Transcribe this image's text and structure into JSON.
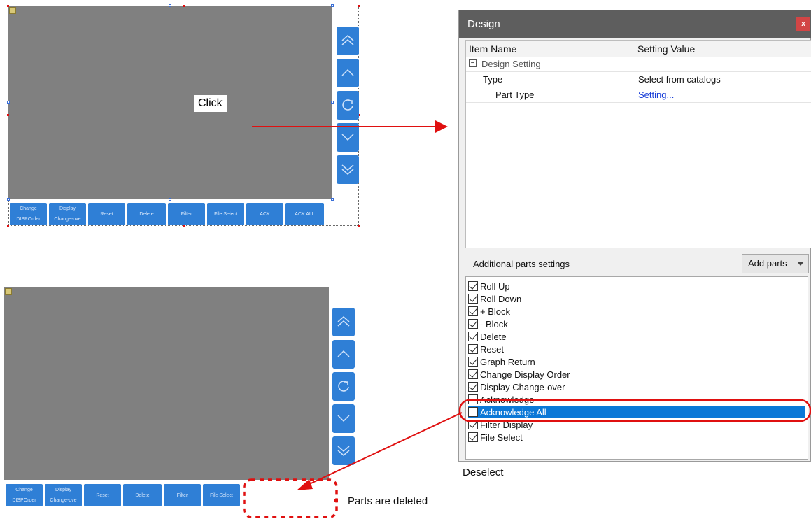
{
  "top_panel": {
    "click_label": "Click",
    "side_buttons": [
      "double-up",
      "up",
      "refresh",
      "down",
      "double-down"
    ],
    "bottom_buttons": [
      {
        "line1": "Change",
        "line2": "DISPOrder"
      },
      {
        "line1": "Display",
        "line2": "Change-ove"
      },
      {
        "line1": "Reset",
        "line2": ""
      },
      {
        "line1": "Delete",
        "line2": ""
      },
      {
        "line1": "Filter",
        "line2": ""
      },
      {
        "line1": "File Select",
        "line2": ""
      },
      {
        "line1": "ACK",
        "line2": ""
      },
      {
        "line1": "ACK ALL",
        "line2": ""
      }
    ]
  },
  "bottom_panel": {
    "side_buttons": [
      "double-up",
      "up",
      "refresh",
      "down",
      "double-down"
    ],
    "bottom_buttons": [
      {
        "line1": "Change",
        "line2": "DISPOrder"
      },
      {
        "line1": "Display",
        "line2": "Change-ove"
      },
      {
        "line1": "Reset",
        "line2": ""
      },
      {
        "line1": "Delete",
        "line2": ""
      },
      {
        "line1": "Filter",
        "line2": ""
      },
      {
        "line1": "File Select",
        "line2": ""
      }
    ],
    "deleted_note": "Parts are deleted"
  },
  "dialog": {
    "title": "Design",
    "close_label": "x",
    "col_item": "Item Name",
    "col_value": "Setting Value",
    "group": "Design Setting",
    "rows": [
      {
        "name": "Type",
        "value": "Select from catalogs"
      },
      {
        "name": "Part Type",
        "value": "Setting..."
      }
    ],
    "additional_label": "Additional parts settings",
    "add_parts_label": "Add parts",
    "parts": [
      {
        "label": "Roll Up",
        "checked": true
      },
      {
        "label": "Roll Down",
        "checked": true
      },
      {
        "label": "+ Block",
        "checked": true
      },
      {
        "label": "- Block",
        "checked": true
      },
      {
        "label": "Delete",
        "checked": true
      },
      {
        "label": "Reset",
        "checked": true
      },
      {
        "label": "Graph Return",
        "checked": true
      },
      {
        "label": "Change Display Order",
        "checked": true
      },
      {
        "label": "Display Change-over",
        "checked": true
      },
      {
        "label": "Acknowledge",
        "checked": false
      },
      {
        "label": "Acknowledge All",
        "checked": false,
        "selected": true
      },
      {
        "label": "Filter Display",
        "checked": true
      },
      {
        "label": "File Select",
        "checked": true
      }
    ],
    "deselect_note": "Deselect"
  },
  "colors": {
    "accent": "#2f7fd6",
    "highlight": "#0a78d7",
    "annotation": "#e01010",
    "screen": "#808080"
  }
}
